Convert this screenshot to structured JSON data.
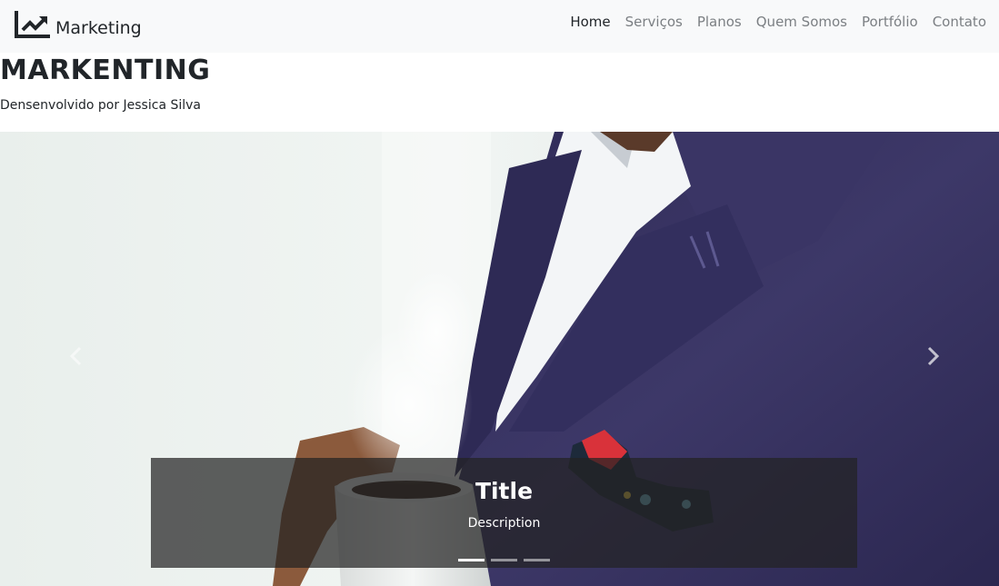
{
  "navbar": {
    "brand": {
      "icon": "chart-line-icon",
      "label": "Marketing"
    },
    "links": [
      {
        "label": "Home",
        "active": true
      },
      {
        "label": "Serviços",
        "active": false
      },
      {
        "label": "Planos",
        "active": false
      },
      {
        "label": "Quem Somos",
        "active": false
      },
      {
        "label": "Portfólio",
        "active": false
      },
      {
        "label": "Contato",
        "active": false
      }
    ]
  },
  "header": {
    "title": "MARKENTING",
    "subtitle": "Densenvolvido por Jessica Silva"
  },
  "carousel": {
    "slide_count": 3,
    "active_index": 0,
    "caption": {
      "title": "Title",
      "description": "Description"
    },
    "prev_icon": "chevron-left-icon",
    "next_icon": "chevron-right-icon"
  },
  "colors": {
    "navbar_bg": "#f8f9fa",
    "nav_active": "#212529",
    "nav_inactive": "#7b7f83",
    "suit": "#3b3766",
    "caption_bg": "rgba(35,35,35,0.72)"
  }
}
